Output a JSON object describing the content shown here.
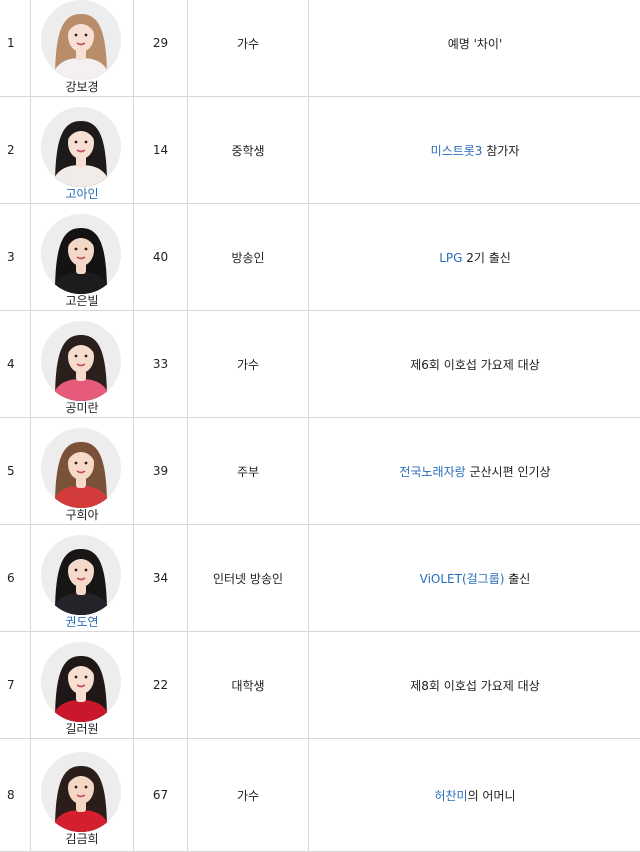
{
  "colors": {
    "link": "#2a6ebb",
    "border": "#d8d8d8",
    "text": "#202122"
  },
  "rows": [
    {
      "no": "1",
      "name": "강보경",
      "name_link": false,
      "age": "29",
      "job": "가수",
      "note_link": "",
      "note_text": "예명 '차이'",
      "photo": {
        "hair": "#b98c6a",
        "cloth": "#f4f0f2",
        "skin": "#f7dfd3"
      }
    },
    {
      "no": "2",
      "name": "고아인",
      "name_link": true,
      "age": "14",
      "job": "중학생",
      "note_link": "미스트롯3",
      "note_text": " 참가자",
      "photo": {
        "hair": "#1e1a1a",
        "cloth": "#f1ece8",
        "skin": "#f7dfd3"
      }
    },
    {
      "no": "3",
      "name": "고은빌",
      "name_link": false,
      "age": "40",
      "job": "방송인",
      "note_link": "LPG",
      "note_text": " 2기 출신",
      "photo": {
        "hair": "#141212",
        "cloth": "#1c1b1d",
        "skin": "#f3d8c8"
      }
    },
    {
      "no": "4",
      "name": "공미란",
      "name_link": false,
      "age": "33",
      "job": "가수",
      "note_link": "",
      "note_text": "제6회 이호섭 가요제 대상",
      "photo": {
        "hair": "#2a1f1c",
        "cloth": "#e65a7a",
        "skin": "#f6dccd"
      }
    },
    {
      "no": "5",
      "name": "구희아",
      "name_link": false,
      "age": "39",
      "job": "주부",
      "note_link": "전국노래자랑",
      "note_text": " 군산시편 인기상",
      "photo": {
        "hair": "#7a5239",
        "cloth": "#d33b3b",
        "skin": "#f6d9c7"
      }
    },
    {
      "no": "6",
      "name": "권도연",
      "name_link": true,
      "age": "34",
      "job": "인터넷 방송인",
      "note_link": "ViOLET(걸그룹)",
      "note_text": " 출신",
      "photo": {
        "hair": "#181515",
        "cloth": "#26222a",
        "skin": "#f5dacb"
      }
    },
    {
      "no": "7",
      "name": "길러원",
      "name_link": false,
      "age": "22",
      "job": "대학생",
      "note_link": "",
      "note_text": "제8회 이호섭 가요제 대상",
      "photo": {
        "hair": "#1f1816",
        "cloth": "#c9182c",
        "skin": "#f7dfd1"
      }
    },
    {
      "no": "8",
      "name": "김금희",
      "name_link": false,
      "age": "67",
      "job": "가수",
      "note_link": "허찬미",
      "note_text": "의 어머니",
      "photo": {
        "hair": "#2b1d1a",
        "cloth": "#d4202e",
        "skin": "#f4d6c4"
      }
    }
  ]
}
